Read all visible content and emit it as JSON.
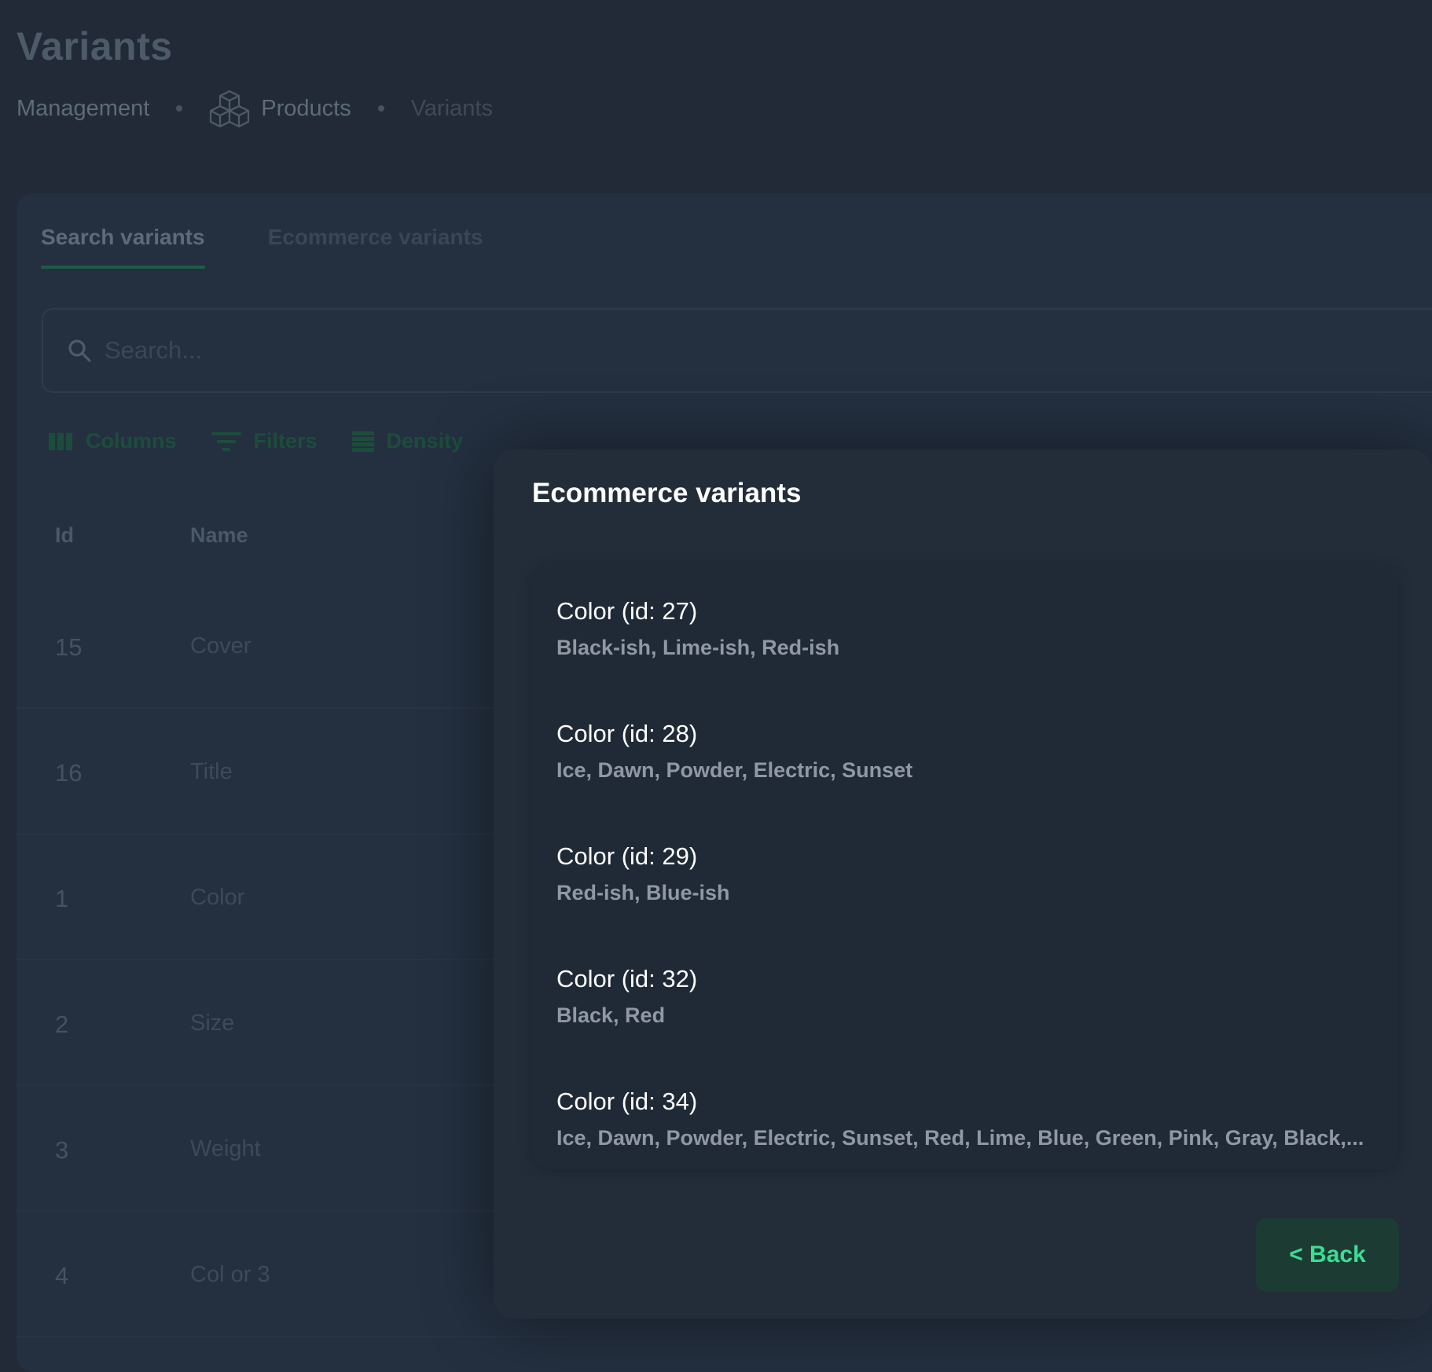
{
  "page": {
    "title": "Variants",
    "breadcrumbs": [
      "Management",
      "Products",
      "Variants"
    ]
  },
  "tabs": [
    "Search variants",
    "Ecommerce variants"
  ],
  "search": {
    "placeholder": "Search..."
  },
  "toolbar": {
    "columns_label": "Columns",
    "filters_label": "Filters",
    "density_label": "Density"
  },
  "table": {
    "columns": [
      "Id",
      "Name"
    ],
    "rows": [
      {
        "id": "15",
        "name": "Cover"
      },
      {
        "id": "16",
        "name": "Title"
      },
      {
        "id": "1",
        "name": "Color"
      },
      {
        "id": "2",
        "name": "Size"
      },
      {
        "id": "3",
        "name": "Weight"
      },
      {
        "id": "4",
        "name": "Col or 3"
      }
    ]
  },
  "modal": {
    "title": "Ecommerce variants",
    "items": [
      {
        "title": "Color (id: 27)",
        "values": "Black-ish, Lime-ish, Red-ish"
      },
      {
        "title": "Color (id: 28)",
        "values": "Ice, Dawn, Powder, Electric, Sunset"
      },
      {
        "title": "Color (id: 29)",
        "values": "Red-ish, Blue-ish"
      },
      {
        "title": "Color (id: 32)",
        "values": "Black, Red"
      },
      {
        "title": "Color (id: 34)",
        "values": "Ice, Dawn, Powder, Electric, Sunset, Red, Lime, Blue, Green, Pink, Gray, Black,..."
      }
    ],
    "back_label": "< Back"
  },
  "colors": {
    "accent": "#3ddc95",
    "accent_bg": "#1c3b33",
    "background": "#212a36",
    "modal_bg": "#232d3a"
  }
}
